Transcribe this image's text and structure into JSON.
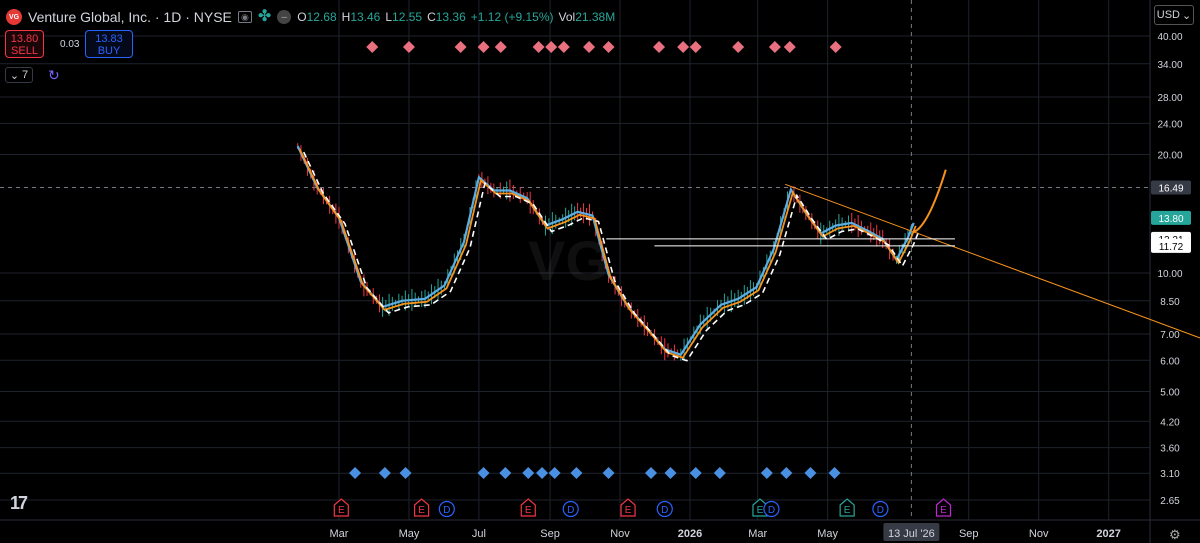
{
  "header": {
    "logo_text": "VG",
    "title": "Venture Global, Inc. · 1D · NYSE",
    "ohlc": [
      {
        "k": "O",
        "v": "12.68"
      },
      {
        "k": "H",
        "v": "13.46"
      },
      {
        "k": "L",
        "v": "12.55"
      },
      {
        "k": "C",
        "v": "13.36"
      },
      {
        "k": "",
        "v": "+1.12 (+9.15%)"
      },
      {
        "k": "Vol",
        "v": "21.38M"
      }
    ]
  },
  "trade": {
    "sell_price": "13.80",
    "sell_label": "SELL",
    "spread": "0.03",
    "buy_price": "13.83",
    "buy_label": "BUY"
  },
  "indicators": {
    "collapse_label": "7"
  },
  "currency": "USD",
  "watermark": "VG",
  "icons": [
    "eye-icon",
    "clover-icon",
    "hide-icon",
    "refresh-icon",
    "chevron-down-icon",
    "tradingview-logo",
    "settings-icon"
  ],
  "colors": {
    "up": "#26a69a",
    "down": "#f23645",
    "orange": "#f7931a",
    "teal": "#5dade2",
    "pink": "#e8707f",
    "blue": "#4a90e2",
    "bg": "#000000"
  },
  "chart_data": {
    "type": "line",
    "y_scale": "log",
    "ylim": [
      2.45,
      43
    ],
    "yticks": [
      "40.00",
      "34.00",
      "28.00",
      "24.00",
      "20.00",
      "16.49",
      "13.80",
      "12.21",
      "11.72",
      "10.00",
      "8.50",
      "7.00",
      "6.00",
      "5.00",
      "4.20",
      "3.60",
      "3.10",
      "2.65"
    ],
    "xticks": [
      "Mar",
      "May",
      "Jul",
      "Sep",
      "Nov",
      "2026",
      "Mar",
      "May",
      "13 Jul '26",
      "Sep",
      "Nov",
      "2027"
    ],
    "price_labels": [
      {
        "label": "16.49",
        "value": 16.49,
        "style": "crosshair"
      },
      {
        "label": "13.80",
        "value": 13.8,
        "style": "last-price"
      },
      {
        "label": "12.21",
        "value": 12.21,
        "style": "level"
      },
      {
        "label": "11.72",
        "value": 11.72,
        "style": "level"
      }
    ],
    "series": [
      {
        "role": "price",
        "x": [
          "2025-01-24",
          "2025-02-10",
          "2025-03-01",
          "2025-03-20",
          "2025-04-08",
          "2025-04-25",
          "2025-05-15",
          "2025-06-01",
          "2025-06-18",
          "2025-07-01",
          "2025-07-14",
          "2025-07-28",
          "2025-08-12",
          "2025-08-28",
          "2025-09-12",
          "2025-09-25",
          "2025-10-08",
          "2025-10-22",
          "2025-11-08",
          "2025-11-25",
          "2025-12-10",
          "2025-12-24",
          "2026-01-10",
          "2026-01-28",
          "2026-02-12",
          "2026-02-28",
          "2026-03-15",
          "2026-03-30",
          "2026-04-12",
          "2026-04-25",
          "2026-05-08",
          "2026-05-22",
          "2026-06-05",
          "2026-06-18",
          "2026-06-30",
          "2026-07-10",
          "2026-07-15"
        ],
        "y": [
          21.0,
          16.5,
          13.8,
          9.5,
          8.2,
          8.5,
          8.6,
          9.3,
          12.0,
          17.5,
          16.2,
          16.2,
          15.5,
          13.2,
          13.7,
          14.3,
          14.0,
          9.9,
          8.2,
          7.2,
          6.4,
          6.2,
          7.4,
          8.3,
          8.6,
          9.2,
          11.5,
          16.3,
          14.2,
          12.6,
          13.2,
          13.4,
          12.8,
          12.2,
          10.8,
          12.3,
          13.4
        ]
      },
      {
        "role": "projection",
        "x": [
          "2026-07-15",
          "2026-07-28",
          "2026-08-12"
        ],
        "y": [
          12.7,
          13.5,
          18.3
        ]
      }
    ],
    "trendlines": [
      {
        "from": [
          "2026-03-25",
          16.8
        ],
        "to": [
          "2027-04-30",
          6.2
        ]
      },
      {
        "from": [
          "2025-10-20",
          12.21
        ],
        "to": [
          "2026-08-20",
          12.21
        ]
      },
      {
        "from": [
          "2025-12-01",
          11.72
        ],
        "to": [
          "2026-08-20",
          11.72
        ]
      }
    ],
    "sell_markers": [
      "2025-03-30",
      "2025-05-01",
      "2025-06-15",
      "2025-07-05",
      "2025-07-20",
      "2025-08-22",
      "2025-09-02",
      "2025-09-13",
      "2025-10-05",
      "2025-10-22",
      "2025-12-05",
      "2025-12-26",
      "2026-01-06",
      "2026-02-12",
      "2026-03-16",
      "2026-03-29",
      "2026-05-08"
    ],
    "buy_markers": [
      "2025-03-15",
      "2025-04-10",
      "2025-04-28",
      "2025-07-05",
      "2025-07-24",
      "2025-08-13",
      "2025-08-25",
      "2025-09-05",
      "2025-09-24",
      "2025-10-22",
      "2025-11-28",
      "2025-12-15",
      "2026-01-06",
      "2026-01-27",
      "2026-03-09",
      "2026-03-26",
      "2026-04-16",
      "2026-05-07"
    ],
    "events": [
      {
        "x": "2025-03-03",
        "type": "E",
        "color": "#f23645"
      },
      {
        "x": "2025-05-12",
        "type": "E",
        "color": "#f23645"
      },
      {
        "x": "2025-06-03",
        "type": "D",
        "color": "#2962ff"
      },
      {
        "x": "2025-08-13",
        "type": "E",
        "color": "#f23645"
      },
      {
        "x": "2025-09-19",
        "type": "D",
        "color": "#2962ff"
      },
      {
        "x": "2025-11-08",
        "type": "E",
        "color": "#f23645"
      },
      {
        "x": "2025-12-10",
        "type": "D",
        "color": "#2962ff"
      },
      {
        "x": "2026-03-03",
        "type": "E",
        "color": "#26a69a"
      },
      {
        "x": "2026-03-13",
        "type": "D",
        "color": "#2962ff"
      },
      {
        "x": "2026-05-18",
        "type": "E",
        "color": "#26a69a"
      },
      {
        "x": "2026-06-16",
        "type": "D",
        "color": "#2962ff"
      },
      {
        "x": "2026-08-10",
        "type": "E",
        "color": "#c026d3"
      }
    ]
  }
}
